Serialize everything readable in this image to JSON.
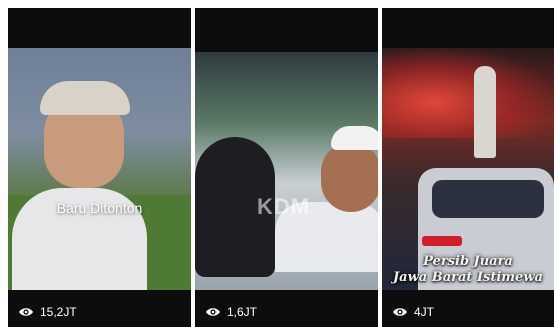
{
  "cards": [
    {
      "label": "Baru Ditonton",
      "views": "15,2JT",
      "icon": "eye-icon"
    },
    {
      "watermark": "KDM",
      "views": "1,6JT",
      "icon": "eye-icon"
    },
    {
      "caption_lines": [
        "Persib Juara",
        "Jawa Barat Istimewa"
      ],
      "views": "4JT",
      "icon": "eye-icon"
    }
  ],
  "colors": {
    "card_bg": "#0d0d0d",
    "text": "#ffffff"
  }
}
